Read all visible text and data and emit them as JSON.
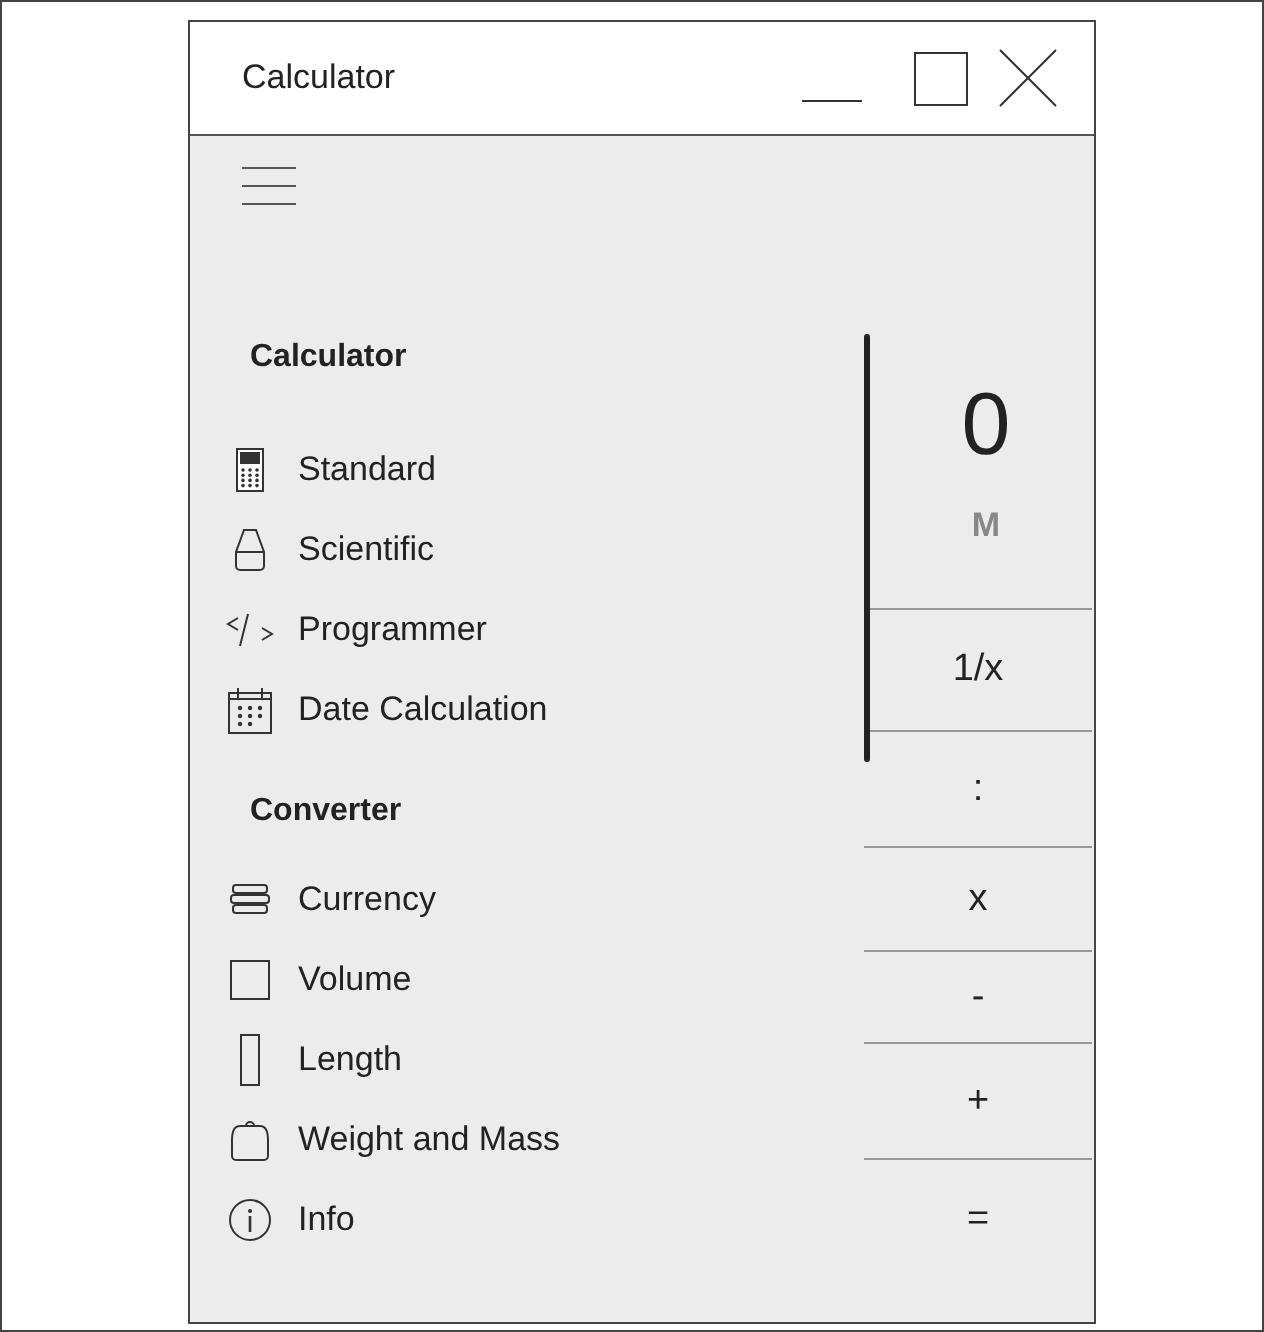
{
  "window": {
    "title": "Calculator"
  },
  "nav": {
    "sections": [
      {
        "heading": "Calculator",
        "items": [
          "Standard",
          "Scientific",
          "Programmer",
          "Date Calculation"
        ]
      },
      {
        "heading": "Converter",
        "items": [
          "Currency",
          "Volume",
          "Length",
          "Weight and Mass",
          "Info"
        ]
      }
    ]
  },
  "display": {
    "value": "0",
    "memory": "M"
  },
  "keys": [
    "1/x",
    ":",
    "x",
    "-",
    "+",
    "="
  ]
}
